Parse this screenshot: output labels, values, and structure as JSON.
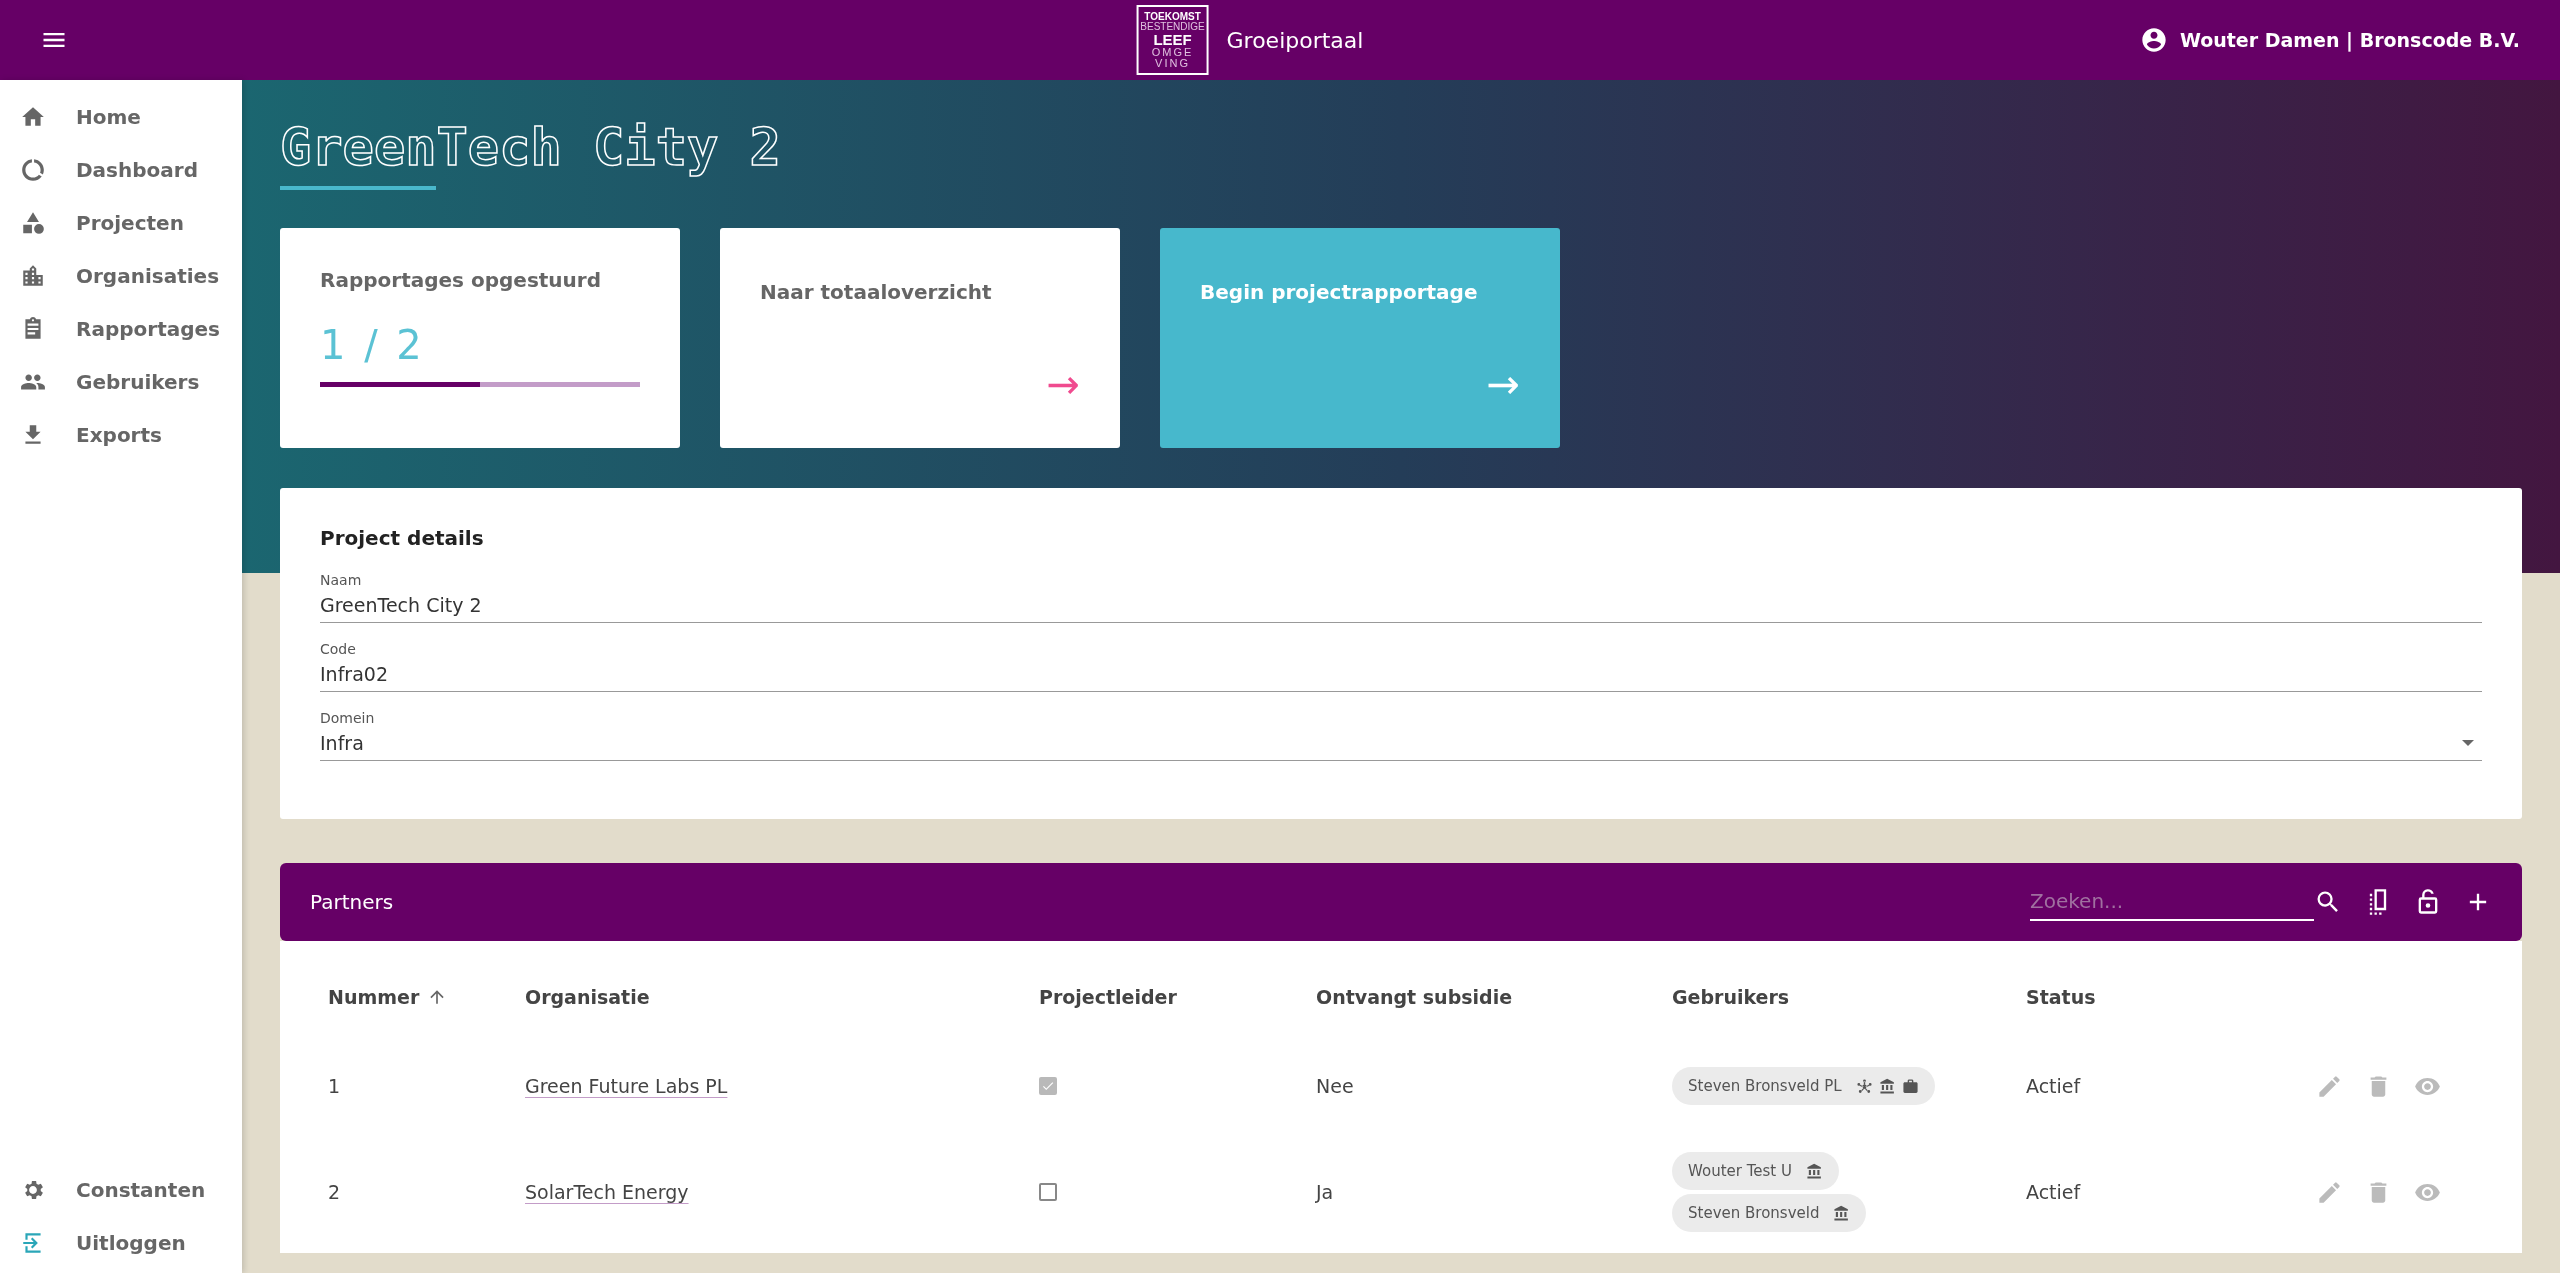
{
  "topbar": {
    "logo_lines": [
      "TOEKOMST",
      "BESTENDIGE",
      "LEEF",
      "OMGE",
      "VING"
    ],
    "app_name": "Groeiportaal",
    "user": "Wouter Damen | Bronscode B.V."
  },
  "sidebar": {
    "items": [
      {
        "label": "Home",
        "kind": "home",
        "selected": false
      },
      {
        "label": "Dashboard",
        "kind": "dashboard",
        "selected": false
      },
      {
        "label": "Projecten",
        "kind": "shapes",
        "selected": false
      },
      {
        "label": "Organisaties",
        "kind": "building",
        "selected": false
      },
      {
        "label": "Rapportages",
        "kind": "clipboard",
        "selected": false
      },
      {
        "label": "Gebruikers",
        "kind": "people",
        "selected": false
      },
      {
        "label": "Exports",
        "kind": "download",
        "selected": false
      }
    ],
    "bottom_items": [
      {
        "label": "Constanten",
        "kind": "gear"
      },
      {
        "label": "Uitloggen",
        "kind": "logout"
      }
    ]
  },
  "page_title": "GreenTech City 2",
  "cards": [
    {
      "kind": "progress",
      "title": "Rapportages opgestuurd",
      "reading": "1 / 2",
      "level": 0.5
    },
    {
      "kind": "link",
      "title": "Naar totaaloverzicht",
      "arrow": "→"
    },
    {
      "kind": "primary",
      "title": "Begin projectrapportage",
      "arrow": "→"
    }
  ],
  "project_details": {
    "title": "Project details",
    "fields": [
      {
        "label": "Naam",
        "value": "GreenTech City 2",
        "kind": "text"
      },
      {
        "label": "Code",
        "value": "Infra02",
        "kind": "text"
      },
      {
        "label": "Domein",
        "value": "Infra",
        "kind": "select"
      }
    ]
  },
  "partners": {
    "title": "Partners",
    "search": {
      "placeholder": "Zoeken..."
    },
    "columns": [
      {
        "label": "Nummer",
        "sorted": true
      },
      {
        "label": "Organisatie",
        "sorted": false
      },
      {
        "label": "Projectleider",
        "sorted": false
      },
      {
        "label": "Ontvangt subsidie",
        "sorted": false
      },
      {
        "label": "Gebruikers",
        "sorted": false
      },
      {
        "label": "Status",
        "sorted": false
      }
    ],
    "rows": [
      {
        "number": "1",
        "organisation": "Green Future Labs PL",
        "project_leader": {
          "checked": true,
          "disabled": true
        },
        "subsidy": "Nee",
        "users": [
          {
            "name": "Steven Bronsveld PL",
            "badges": [
              {
                "kind": "network"
              },
              {
                "kind": "institution"
              },
              {
                "kind": "briefcase"
              }
            ]
          }
        ],
        "status": "Actief"
      },
      {
        "number": "2",
        "organisation": "SolarTech Energy",
        "project_leader": {
          "checked": false,
          "disabled": false
        },
        "subsidy": "Ja",
        "users": [
          {
            "name": "Wouter Test U",
            "badges": [
              {
                "kind": "institution"
              }
            ]
          },
          {
            "name": "Steven Bronsveld",
            "badges": [
              {
                "kind": "institution"
              }
            ]
          }
        ],
        "status": "Actief"
      }
    ]
  }
}
